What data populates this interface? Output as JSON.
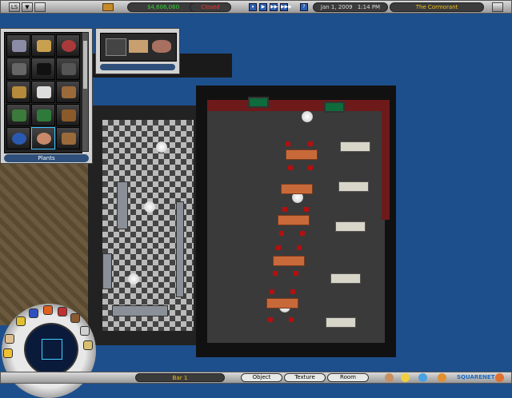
{
  "topbar": {
    "menu_btn": "LS",
    "arrow_btn": "▼",
    "money": "$4,606,060",
    "alert": "Closed",
    "date": "Jan 1, 2009",
    "time": "1:14 PM",
    "venue": "The Cormorant",
    "help_btn": "?",
    "speed_controls": [
      "⏸",
      "▶",
      "▶▶",
      "▶▶▶"
    ]
  },
  "catalog": {
    "category": "Plants"
  },
  "bottombar": {
    "room_name": "Bar 1",
    "tabs": [
      "Object",
      "Texture",
      "Room"
    ],
    "watermark": "SQUARENET"
  },
  "colors": {
    "money": "#2fd62f",
    "alert": "#ff3030",
    "venue": "#f0c020",
    "accent": "#2d4f7a"
  }
}
